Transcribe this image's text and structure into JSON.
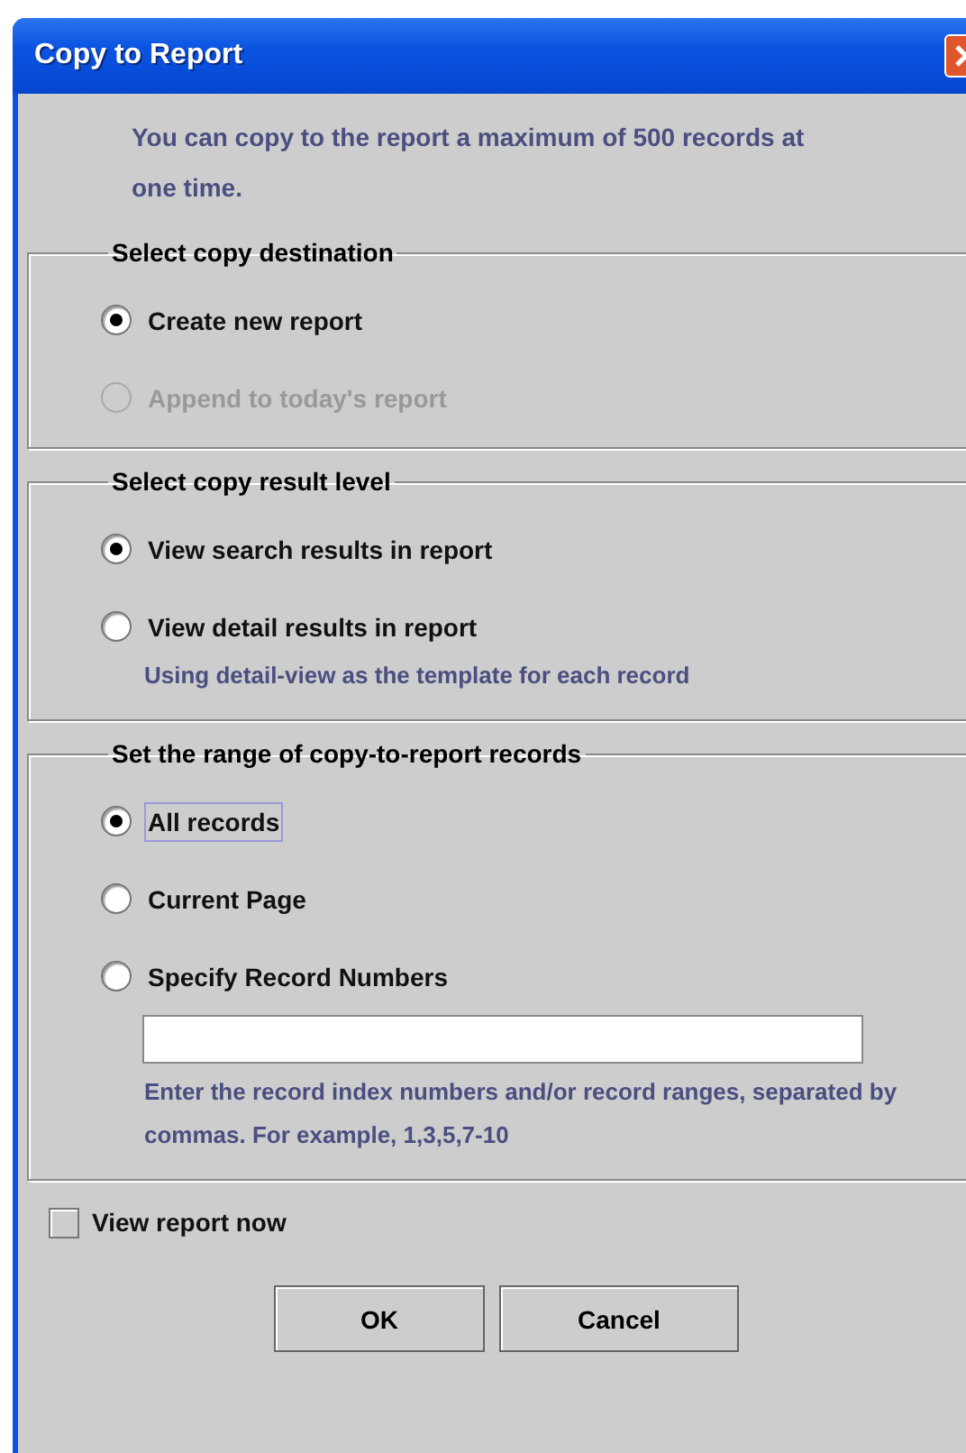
{
  "window": {
    "title": "Copy to Report"
  },
  "intro": "You can copy to the report a maximum of 500 records at one time.",
  "groups": [
    {
      "title": "Select copy destination",
      "options": [
        {
          "kind": "radio",
          "label": "Create new report",
          "selected": true,
          "disabled": false,
          "focused": false
        },
        {
          "kind": "radio",
          "label": "Append to today's report",
          "selected": false,
          "disabled": true,
          "focused": false
        }
      ]
    },
    {
      "title": "Select copy result level",
      "options": [
        {
          "kind": "radio",
          "label": "View search results in report",
          "selected": true,
          "disabled": false,
          "focused": false
        },
        {
          "kind": "radio",
          "label": "View detail results in report",
          "selected": false,
          "disabled": false,
          "focused": false,
          "hint": "Using detail-view as the template for each record"
        }
      ]
    },
    {
      "title": "Set the range of copy-to-report records",
      "options": [
        {
          "kind": "radio",
          "label": "All records",
          "selected": true,
          "disabled": false,
          "focused": true
        },
        {
          "kind": "radio",
          "label": "Current Page",
          "selected": false,
          "disabled": false,
          "focused": false
        },
        {
          "kind": "radio-with-field",
          "label": "Specify Record Numbers",
          "selected": false,
          "disabled": false,
          "focused": false,
          "hint": "Enter the record index numbers and/or record ranges, separated by commas. For example, 1,3,5,7-10"
        }
      ]
    }
  ],
  "checkbox": {
    "label": "View report now",
    "checked": false
  },
  "buttons": [
    "OK",
    "Cancel"
  ]
}
